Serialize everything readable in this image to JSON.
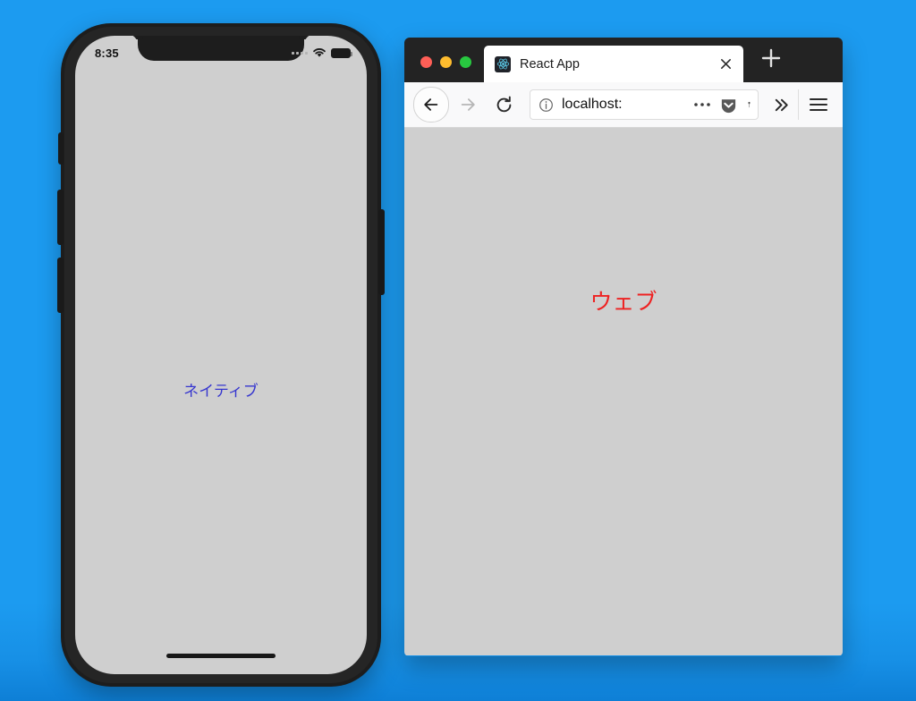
{
  "background": {
    "color": "#1c9bf0"
  },
  "phone": {
    "name": "iphone-x-mockup",
    "status_bar": {
      "time": "8:35",
      "signal_icon": "signal-dots-icon",
      "wifi_icon": "wifi-icon",
      "battery_icon": "battery-full-icon"
    },
    "screen": {
      "label": "ネイティブ",
      "label_color": "#3636cf",
      "background_color": "#cfcfcf"
    },
    "buttons": {
      "silent_switch": "silent-switch",
      "volume_up": "volume-up-button",
      "volume_down": "volume-down-button",
      "power": "power-button"
    },
    "home_indicator": "home-indicator"
  },
  "browser": {
    "name": "firefox-window",
    "window_controls": {
      "close": "close",
      "minimize": "minimize",
      "maximize": "maximize",
      "close_color": "#ff5f57",
      "minimize_color": "#febc2e",
      "maximize_color": "#28c840"
    },
    "tab": {
      "title": "React App",
      "favicon": "react-logo-icon",
      "close_label": "✕"
    },
    "new_tab_label": "+",
    "toolbar": {
      "back_icon": "back-arrow-icon",
      "forward_icon": "forward-arrow-icon",
      "reload_icon": "reload-icon",
      "identity_icon": "info-circle-icon",
      "url": "localhost:",
      "page_actions_icon": "ellipsis-icon",
      "pocket_icon": "pocket-shield-icon",
      "extension_icon": "extension-icon",
      "overflow_icon": "double-chevron-right-icon",
      "menu_icon": "hamburger-menu-icon"
    },
    "viewport": {
      "label": "ウェブ",
      "label_color": "#ee2222",
      "background_color": "#cfcfcf"
    }
  }
}
